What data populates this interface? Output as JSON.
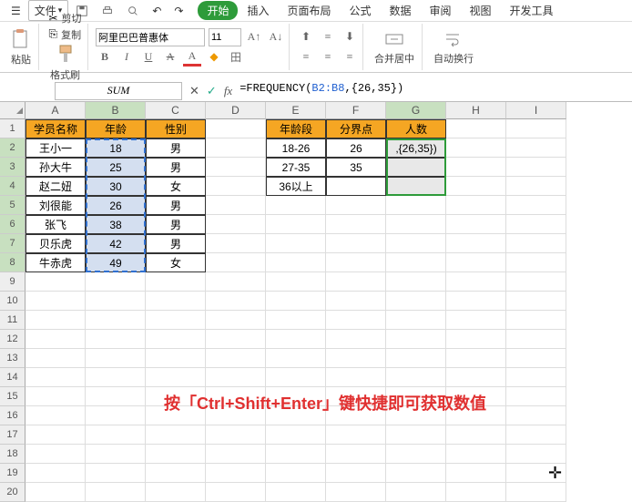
{
  "menu": {
    "file": "文件",
    "tabs": [
      "开始",
      "插入",
      "页面布局",
      "公式",
      "数据",
      "审阅",
      "视图",
      "开发工具"
    ],
    "active_tab": 0
  },
  "ribbon": {
    "paste": "粘贴",
    "cut": "剪切",
    "copy": "复制",
    "fmt_painter": "格式刷",
    "font_name": "阿里巴巴普惠体",
    "font_size": "11",
    "merge": "合并居中",
    "autowrap": "自动换行"
  },
  "name_box": "SUM",
  "formula": {
    "prefix": "=FREQUENCY(",
    "range": "B2:B8",
    "suffix": ",{26,35})"
  },
  "cols": [
    "A",
    "B",
    "C",
    "D",
    "E",
    "F",
    "G",
    "H",
    "I"
  ],
  "rows_vis": 20,
  "t1": {
    "headers": [
      "学员名称",
      "年龄",
      "性别"
    ],
    "rows": [
      [
        "王小一",
        "18",
        "男"
      ],
      [
        "孙大牛",
        "25",
        "男"
      ],
      [
        "赵二妞",
        "30",
        "女"
      ],
      [
        "刘很能",
        "26",
        "男"
      ],
      [
        "张飞",
        "38",
        "男"
      ],
      [
        "贝乐虎",
        "42",
        "男"
      ],
      [
        "牛赤虎",
        "49",
        "女"
      ]
    ]
  },
  "t2": {
    "headers": [
      "年龄段",
      "分界点",
      "人数"
    ],
    "rows": [
      [
        "18-26",
        "26",
        ",{26,35})"
      ],
      [
        "27-35",
        "35",
        ""
      ],
      [
        "36以上",
        "",
        ""
      ]
    ]
  },
  "note": "按「Ctrl+Shift+Enter」键快捷即可获取数值",
  "fmt": {
    "B": "B",
    "I": "I",
    "U": "U",
    "A": "A",
    "S": "田"
  },
  "chart_data": null
}
